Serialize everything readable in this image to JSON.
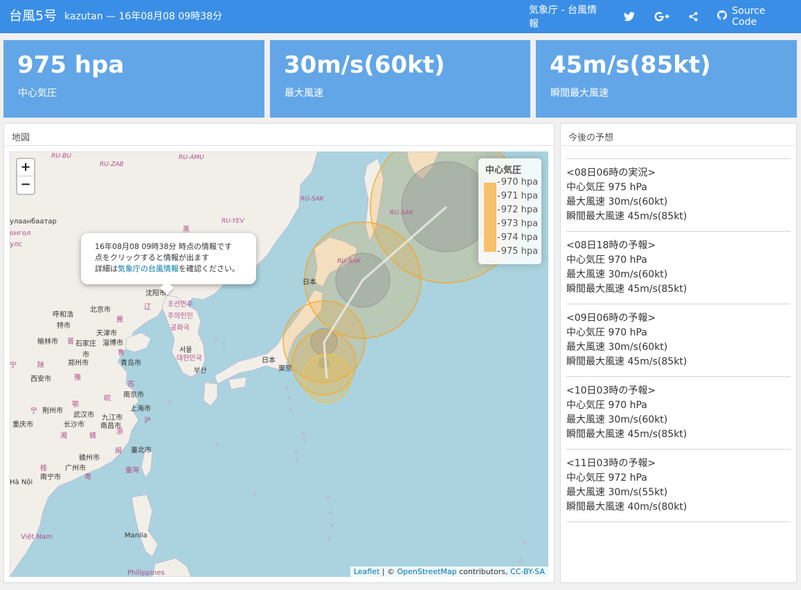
{
  "header": {
    "brand": "台風5号",
    "subtitle": "kazutan — 16年08月08 09時38分",
    "jma_link": "気象庁 - 台風情報",
    "twitter_icon": "twitter-icon",
    "gplus_icon": "google-plus-icon",
    "share_icon": "share-icon",
    "github_icon": "github-icon",
    "source_label": "Source Code"
  },
  "cards": [
    {
      "value": "975 hpa",
      "label": "中心気圧"
    },
    {
      "value": "30m/s(60kt)",
      "label": "最大風速"
    },
    {
      "value": "45m/s(85kt)",
      "label": "瞬間最大風速"
    }
  ],
  "map_panel": {
    "title": "地図",
    "zoom_in": "+",
    "zoom_out": "−",
    "popup": {
      "line1": "16年08月08 09時38分 時点の情報です",
      "line2": "点をクリックすると情報が出ます",
      "line3_prefix": "詳細は",
      "line3_link": "気象庁の台風情報",
      "line3_suffix": "を確認ください。"
    },
    "legend": {
      "title": "中心気圧",
      "ticks": [
        "970 hpa",
        "971 hpa",
        "972 hpa",
        "973 hpa",
        "974 hpa",
        "975 hpa"
      ]
    },
    "attribution": {
      "leaflet": "Leaflet",
      "sep": " | © ",
      "osm": "OpenStreetMap",
      "contributors": " contributors, ",
      "license": "CC-BY-SA"
    },
    "labels": {
      "ru_bu": "RU-BU",
      "ru_zab": "RU-ZAB",
      "ru_amu": "RU-AMU",
      "ru_sak1": "RU-SAK",
      "ru_yev": "RU-YEV",
      "ru_sak2": "RU-SAK",
      "ru_sak3": "RU-SAK",
      "ulaanbaatar": "улаанбаатар",
      "mongol": "онгол",
      "uls": "улс",
      "hei": "黑",
      "nippon1": "日本",
      "shenyang": "沈阳市",
      "chosen": "조선민주",
      "juuiinmin": "주의인민",
      "konghwa": "공화국",
      "seoul": "서울",
      "korea": "대한민국",
      "busan": "부산",
      "beijing": "北京市",
      "hohhot": "呼和浩",
      "tejshi": "特市",
      "tianjin": "天津市",
      "liao": "辽",
      "yulin": "榆林市",
      "shijiazhuang": "石家庄",
      "shi": "市",
      "zibo": "淄博市",
      "ji": "冀",
      "jin": "晋",
      "lu": "鲁",
      "zhengzhou": "郑州市",
      "qingdao": "青岛市",
      "xian": "西安市",
      "shaan": "陕",
      "yu": "豫",
      "su": "苏",
      "nanjing": "南京市",
      "shanghai": "上海市",
      "wan": "皖",
      "hu": "沪",
      "zhe": "浙",
      "jingzhou": "荆州市",
      "wuhan": "武汉市",
      "jiujiang": "九江市",
      "nanchang": "南昌市",
      "changsha": "长沙市",
      "chongqing": "重庆市",
      "e": "鄂",
      "xiang": "湘",
      "gan": "赣",
      "min": "闽",
      "taipei": "臺北市",
      "taiwan": "臺灣",
      "ganzhou": "赣州市",
      "guangzhou": "广州市",
      "nanning": "南宁市",
      "gui": "桂",
      "yue": "粤",
      "hanoi": "Hà Nội",
      "vietnam": "Việt Nam",
      "manila": "Manila",
      "philippines": "Philippines",
      "nippon2": "日本",
      "tokyo": "東京",
      "ning": "宁",
      "ning2": "宁"
    }
  },
  "forecast_panel": {
    "title": "今後の予想",
    "items": [
      {
        "heading": "<08日06時の実況>",
        "pressure": "中心気圧 975 hPa",
        "wind": "最大風速 30m/s(60kt)",
        "gust": "瞬間最大風速 45m/s(85kt)"
      },
      {
        "heading": "<08日18時の予報>",
        "pressure": "中心気圧 970 hPa",
        "wind": "最大風速 30m/s(60kt)",
        "gust": "瞬間最大風速 45m/s(85kt)"
      },
      {
        "heading": "<09日06時の予報>",
        "pressure": "中心気圧 970 hPa",
        "wind": "最大風速 30m/s(60kt)",
        "gust": "瞬間最大風速 45m/s(85kt)"
      },
      {
        "heading": "<10日03時の予報>",
        "pressure": "中心気圧 970 hPa",
        "wind": "最大風速 30m/s(60kt)",
        "gust": "瞬間最大風速 45m/s(85kt)"
      },
      {
        "heading": "<11日03時の予報>",
        "pressure": "中心気圧 972 hPa",
        "wind": "最大風速 30m/s(55kt)",
        "gust": "瞬間最大風速 40m/s(80kt)"
      }
    ]
  },
  "colors": {
    "navbar": "#3a8ee6",
    "card": "#62a6e8",
    "sea": "#aad3df",
    "land": "#f2efe9",
    "storm_orange": "#f5a623"
  }
}
